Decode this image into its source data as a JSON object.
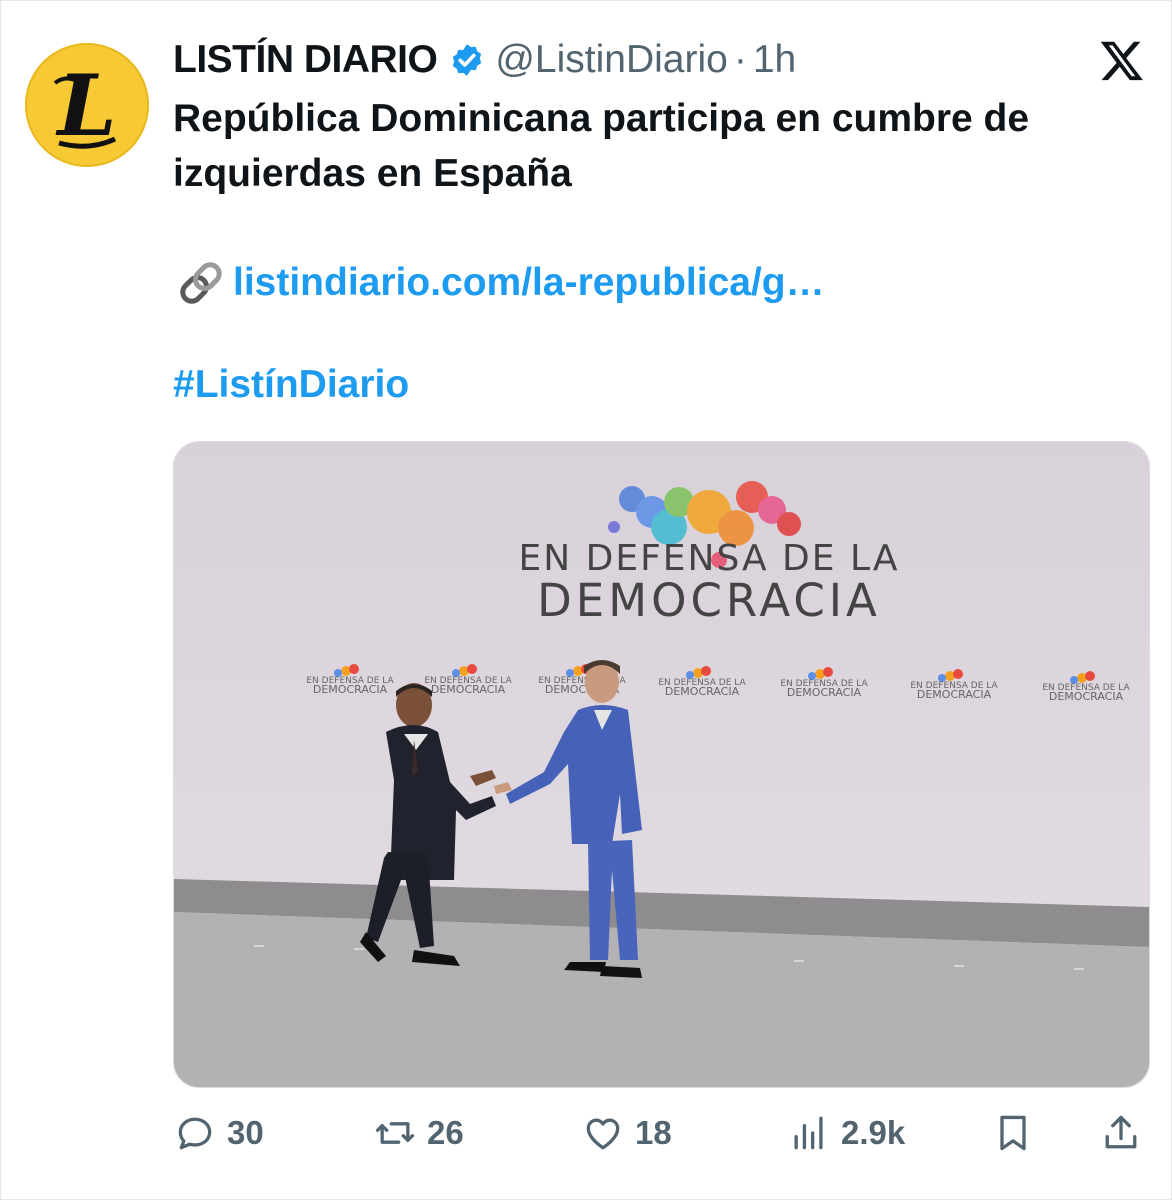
{
  "tweet": {
    "author_name": "LISTÍN DIARIO",
    "handle": "@ListinDiario",
    "separator": "·",
    "time": "1h",
    "text": "República Dominicana participa en cumbre de izquierdas en España",
    "link": "listindiario.com/la-republica/g…",
    "hashtag": "#ListínDiario"
  },
  "media": {
    "backdrop_line1": "EN DEFENSA DE LA",
    "backdrop_line2": "DEMOCRACIA",
    "small_logo_line1": "EN DEFENSA DE LA",
    "small_logo_line2": "DEMOCRACIA"
  },
  "actions": {
    "replies": "30",
    "reposts": "26",
    "likes": "18",
    "views": "2.9k"
  },
  "colors": {
    "accent": "#1d9bf0",
    "muted": "#536471",
    "avatar": "#f6c935"
  },
  "icons": [
    "newspaper-logo-icon",
    "verified-badge-icon",
    "x-logo-icon",
    "link-icon",
    "reply-icon",
    "repost-icon",
    "like-icon",
    "views-icon",
    "bookmark-icon",
    "share-icon"
  ]
}
